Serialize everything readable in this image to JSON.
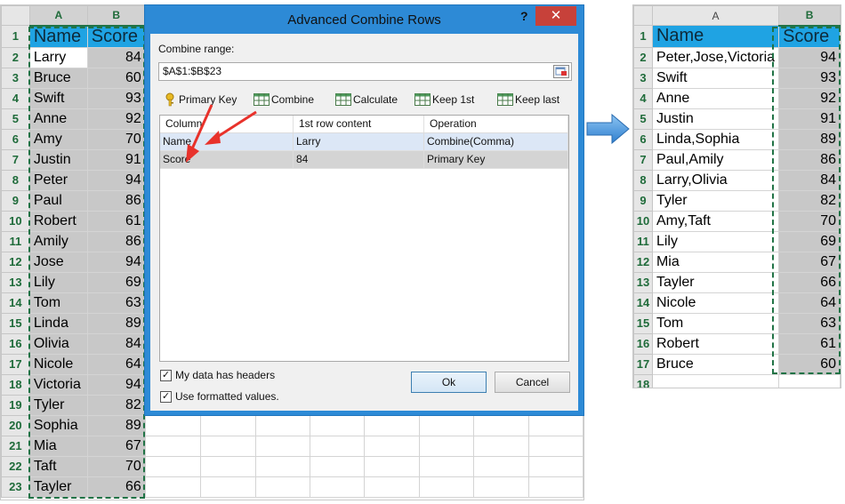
{
  "left_sheet": {
    "columns": [
      "A",
      "B"
    ],
    "header": {
      "name": "Name",
      "score": "Score"
    },
    "rows": [
      {
        "n": "2",
        "name": "Larry",
        "score": "84"
      },
      {
        "n": "3",
        "name": "Bruce",
        "score": "60"
      },
      {
        "n": "4",
        "name": "Swift",
        "score": "93"
      },
      {
        "n": "5",
        "name": "Anne",
        "score": "92"
      },
      {
        "n": "6",
        "name": "Amy",
        "score": "70"
      },
      {
        "n": "7",
        "name": "Justin",
        "score": "91"
      },
      {
        "n": "8",
        "name": "Peter",
        "score": "94"
      },
      {
        "n": "9",
        "name": "Paul",
        "score": "86"
      },
      {
        "n": "10",
        "name": "Robert",
        "score": "61"
      },
      {
        "n": "11",
        "name": "Amily",
        "score": "86"
      },
      {
        "n": "12",
        "name": "Jose",
        "score": "94"
      },
      {
        "n": "13",
        "name": "Lily",
        "score": "69"
      },
      {
        "n": "14",
        "name": "Tom",
        "score": "63"
      },
      {
        "n": "15",
        "name": "Linda",
        "score": "89"
      },
      {
        "n": "16",
        "name": "Olivia",
        "score": "84"
      },
      {
        "n": "17",
        "name": "Nicole",
        "score": "64"
      },
      {
        "n": "18",
        "name": "Victoria",
        "score": "94"
      },
      {
        "n": "19",
        "name": "Tyler",
        "score": "82"
      },
      {
        "n": "20",
        "name": "Sophia",
        "score": "89"
      },
      {
        "n": "21",
        "name": "Mia",
        "score": "67"
      },
      {
        "n": "22",
        "name": "Taft",
        "score": "70"
      },
      {
        "n": "23",
        "name": "Tayler",
        "score": "66"
      }
    ]
  },
  "right_sheet": {
    "columns": [
      "A",
      "B"
    ],
    "header": {
      "name": "Name",
      "score": "Score"
    },
    "rows": [
      {
        "n": "2",
        "name": "Peter,Jose,Victoria",
        "score": "94"
      },
      {
        "n": "3",
        "name": "Swift",
        "score": "93"
      },
      {
        "n": "4",
        "name": "Anne",
        "score": "92"
      },
      {
        "n": "5",
        "name": "Justin",
        "score": "91"
      },
      {
        "n": "6",
        "name": "Linda,Sophia",
        "score": "89"
      },
      {
        "n": "7",
        "name": "Paul,Amily",
        "score": "86"
      },
      {
        "n": "8",
        "name": "Larry,Olivia",
        "score": "84"
      },
      {
        "n": "9",
        "name": "Tyler",
        "score": "82"
      },
      {
        "n": "10",
        "name": "Amy,Taft",
        "score": "70"
      },
      {
        "n": "11",
        "name": "Lily",
        "score": "69"
      },
      {
        "n": "12",
        "name": "Mia",
        "score": "67"
      },
      {
        "n": "13",
        "name": "Tayler",
        "score": "66"
      },
      {
        "n": "14",
        "name": "Nicole",
        "score": "64"
      },
      {
        "n": "15",
        "name": "Tom",
        "score": "63"
      },
      {
        "n": "16",
        "name": "Robert",
        "score": "61"
      },
      {
        "n": "17",
        "name": "Bruce",
        "score": "60"
      }
    ],
    "trailing_row": "18"
  },
  "dialog": {
    "title": "Advanced Combine Rows",
    "help": "?",
    "close": "✕",
    "range_label": "Combine range:",
    "range_value": "$A$1:$B$23",
    "tools": {
      "primary_key": "Primary Key",
      "combine": "Combine",
      "calculate": "Calculate",
      "keep_first": "Keep 1st",
      "keep_last": "Keep last"
    },
    "grid": {
      "headers": [
        "Column",
        "1st row content",
        "Operation"
      ],
      "rows": [
        {
          "column": "Name",
          "content": "Larry",
          "operation": "Combine(Comma)"
        },
        {
          "column": "Score",
          "content": "84",
          "operation": "Primary Key"
        }
      ]
    },
    "options": {
      "headers_label": "My data has headers",
      "formatted_label": "Use formatted values.",
      "check_mark": "✓"
    },
    "buttons": {
      "ok": "Ok",
      "cancel": "Cancel"
    }
  },
  "colors": {
    "header_fill": "#1fa3e3",
    "selected_fill": "#c8c8c8",
    "title_bar": "#2d8ad6",
    "close_button": "#c7413a",
    "row_number": "#1f6b3a",
    "annotation_arrow": "#e8322b",
    "transition_arrow": "#3a8fd6"
  }
}
